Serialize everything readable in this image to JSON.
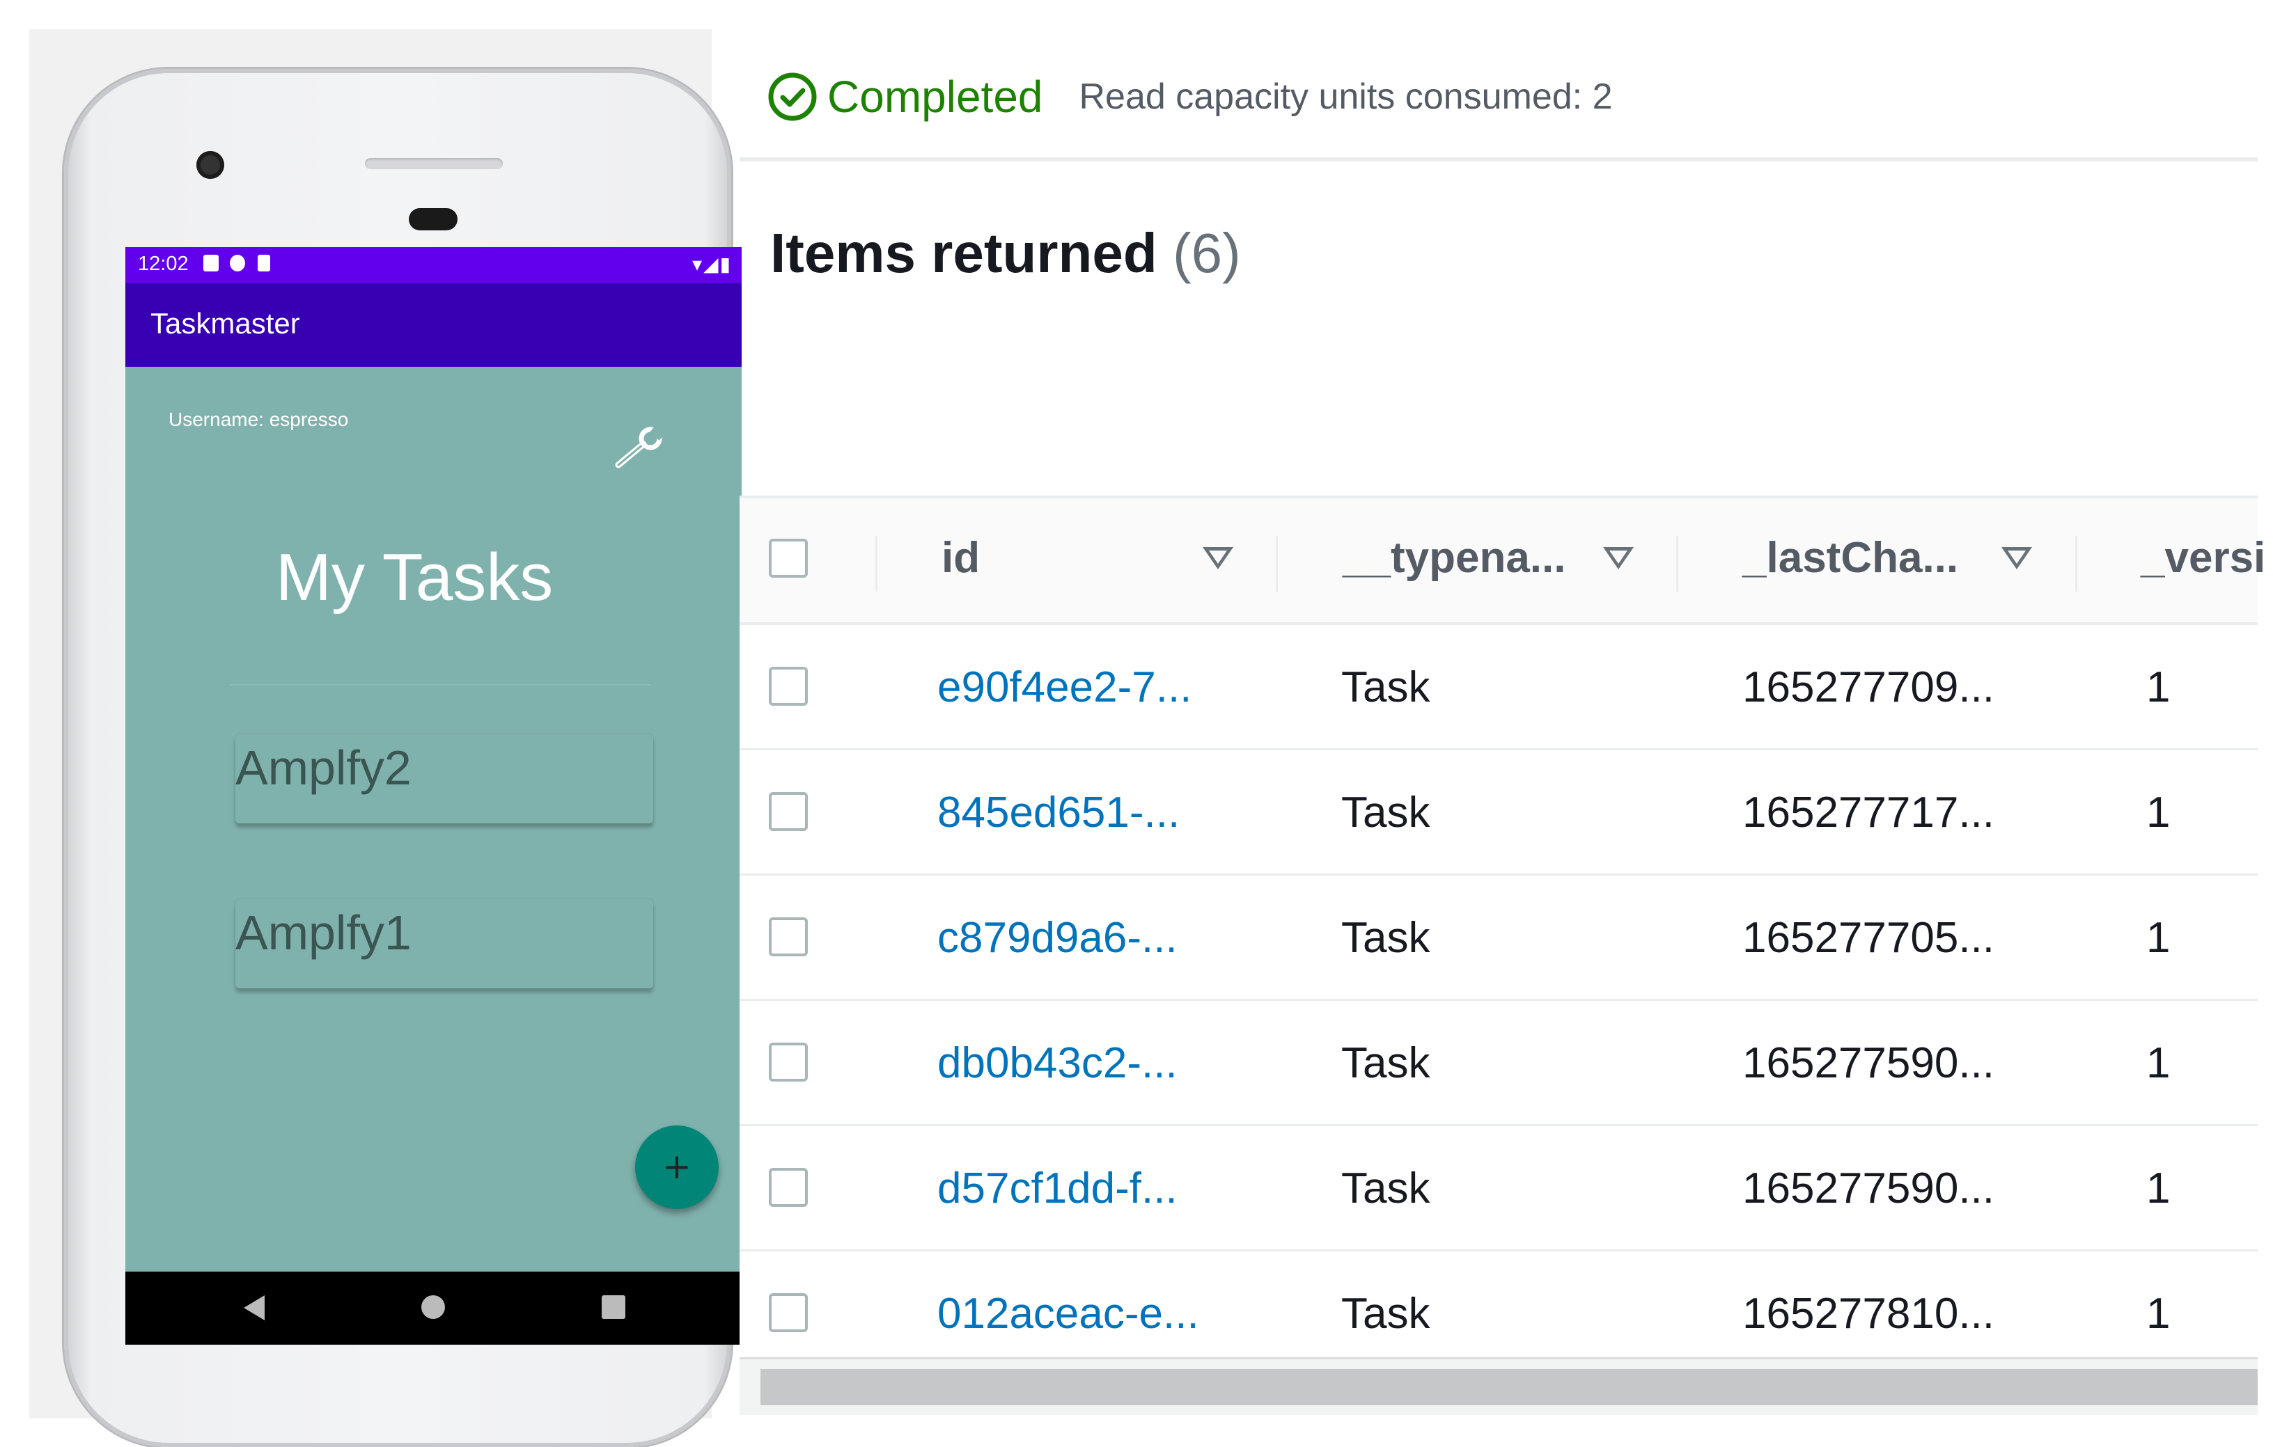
{
  "phone": {
    "status_time": "12:02",
    "status_right": "▾◢▮",
    "app_title": "Taskmaster",
    "username": "Username: espresso",
    "heading": "My Tasks",
    "tasks": [
      "Amplfy2",
      "Amplfy1"
    ],
    "fab_label": "+",
    "colors": {
      "status_bar": "#6200ee",
      "app_bar": "#3700b3",
      "background": "#80b2ad",
      "fab": "#018577"
    }
  },
  "dynamo": {
    "status": "Completed",
    "capacity": "Read capacity units consumed: 2",
    "items_title": "Items returned",
    "items_count": "(6)",
    "columns": [
      "id",
      "__typena...",
      "_lastCha...",
      "_versi"
    ],
    "rows": [
      {
        "id": "e90f4ee2-7...",
        "typename": "Task",
        "lastChanged": "165277709...",
        "version": "1"
      },
      {
        "id": "845ed651-...",
        "typename": "Task",
        "lastChanged": "165277717...",
        "version": "1"
      },
      {
        "id": "c879d9a6-...",
        "typename": "Task",
        "lastChanged": "165277705...",
        "version": "1"
      },
      {
        "id": "db0b43c2-...",
        "typename": "Task",
        "lastChanged": "165277590...",
        "version": "1"
      },
      {
        "id": "d57cf1dd-f...",
        "typename": "Task",
        "lastChanged": "165277590...",
        "version": "1"
      },
      {
        "id": "012aceac-e...",
        "typename": "Task",
        "lastChanged": "165277810...",
        "version": "1"
      }
    ],
    "colors": {
      "success": "#1d8102",
      "link": "#0073bb"
    }
  }
}
